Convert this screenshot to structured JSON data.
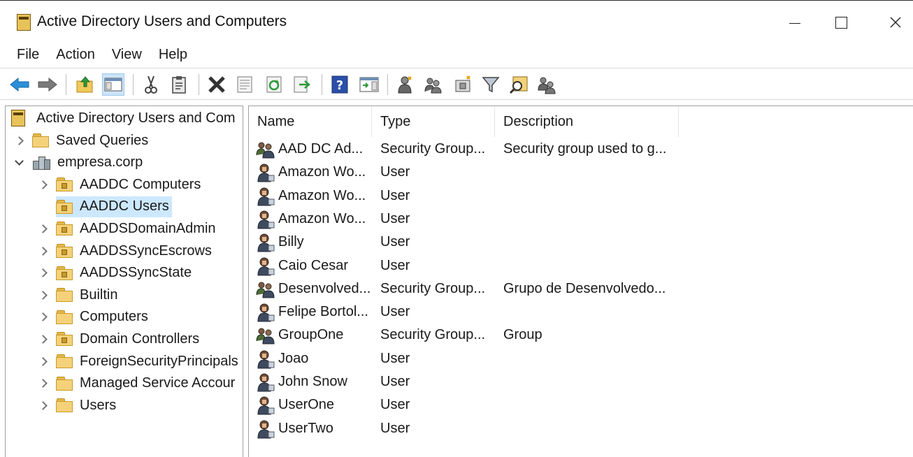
{
  "window": {
    "title": "Active Directory Users and Computers",
    "icon": "ad-console-icon"
  },
  "caption_buttons": {
    "minimize": "minimize-icon",
    "maximize": "maximize-icon",
    "close": "close-icon"
  },
  "menu": [
    "File",
    "Action",
    "View",
    "Help"
  ],
  "toolbar": [
    {
      "name": "back-icon"
    },
    {
      "name": "forward-icon"
    },
    {
      "name": "up-folder-icon"
    },
    {
      "name": "show-hide-console-tree-icon",
      "active": true
    },
    {
      "name": "cut-icon"
    },
    {
      "name": "paste-icon"
    },
    {
      "name": "delete-icon"
    },
    {
      "name": "properties-icon"
    },
    {
      "name": "refresh-icon"
    },
    {
      "name": "export-list-icon"
    },
    {
      "name": "help-icon"
    },
    {
      "name": "show-action-pane-icon"
    },
    {
      "name": "new-user-icon"
    },
    {
      "name": "new-group-icon"
    },
    {
      "name": "new-ou-icon"
    },
    {
      "name": "filter-icon"
    },
    {
      "name": "find-icon"
    },
    {
      "name": "add-to-group-icon"
    }
  ],
  "tree": {
    "root": "Active Directory Users and Com",
    "items": [
      {
        "label": "Saved Queries",
        "level": 1,
        "expander": "collapsed",
        "icon": "folder"
      },
      {
        "label": "empresa.corp",
        "level": 1,
        "expander": "expanded",
        "icon": "domain"
      },
      {
        "label": "AADDC Computers",
        "level": 2,
        "expander": "collapsed",
        "icon": "ou"
      },
      {
        "label": "AADDC Users",
        "level": 2,
        "expander": "none",
        "icon": "ou",
        "selected": true
      },
      {
        "label": "AADDSDomainAdmin",
        "level": 2,
        "expander": "collapsed",
        "icon": "ou"
      },
      {
        "label": "AADDSSyncEscrows",
        "level": 2,
        "expander": "collapsed",
        "icon": "ou"
      },
      {
        "label": "AADDSSyncState",
        "level": 2,
        "expander": "collapsed",
        "icon": "ou"
      },
      {
        "label": "Builtin",
        "level": 2,
        "expander": "collapsed",
        "icon": "folder"
      },
      {
        "label": "Computers",
        "level": 2,
        "expander": "collapsed",
        "icon": "folder"
      },
      {
        "label": "Domain Controllers",
        "level": 2,
        "expander": "collapsed",
        "icon": "ou"
      },
      {
        "label": "ForeignSecurityPrincipals",
        "level": 2,
        "expander": "collapsed",
        "icon": "folder"
      },
      {
        "label": "Managed Service Accour",
        "level": 2,
        "expander": "collapsed",
        "icon": "folder"
      },
      {
        "label": "Users",
        "level": 2,
        "expander": "collapsed",
        "icon": "folder"
      }
    ]
  },
  "list": {
    "columns": [
      "Name",
      "Type",
      "Description"
    ],
    "rows": [
      {
        "name": "AAD DC Ad...",
        "type": "Security Group...",
        "description": "Security group used to g...",
        "kind": "group"
      },
      {
        "name": "Amazon Wo...",
        "type": "User",
        "description": "",
        "kind": "user"
      },
      {
        "name": "Amazon Wo...",
        "type": "User",
        "description": "",
        "kind": "user"
      },
      {
        "name": "Amazon Wo...",
        "type": "User",
        "description": "",
        "kind": "user"
      },
      {
        "name": "Billy",
        "type": "User",
        "description": "",
        "kind": "user"
      },
      {
        "name": "Caio Cesar",
        "type": "User",
        "description": "",
        "kind": "user"
      },
      {
        "name": "Desenvolved...",
        "type": "Security Group...",
        "description": "Grupo de Desenvolvedo...",
        "kind": "group"
      },
      {
        "name": "Felipe Bortol...",
        "type": "User",
        "description": "",
        "kind": "user"
      },
      {
        "name": "GroupOne",
        "type": "Security Group...",
        "description": "Group",
        "kind": "group"
      },
      {
        "name": "Joao",
        "type": "User",
        "description": "",
        "kind": "user"
      },
      {
        "name": "John Snow",
        "type": "User",
        "description": "",
        "kind": "user"
      },
      {
        "name": "UserOne",
        "type": "User",
        "description": "",
        "kind": "user"
      },
      {
        "name": "UserTwo",
        "type": "User",
        "description": "",
        "kind": "user"
      }
    ]
  }
}
